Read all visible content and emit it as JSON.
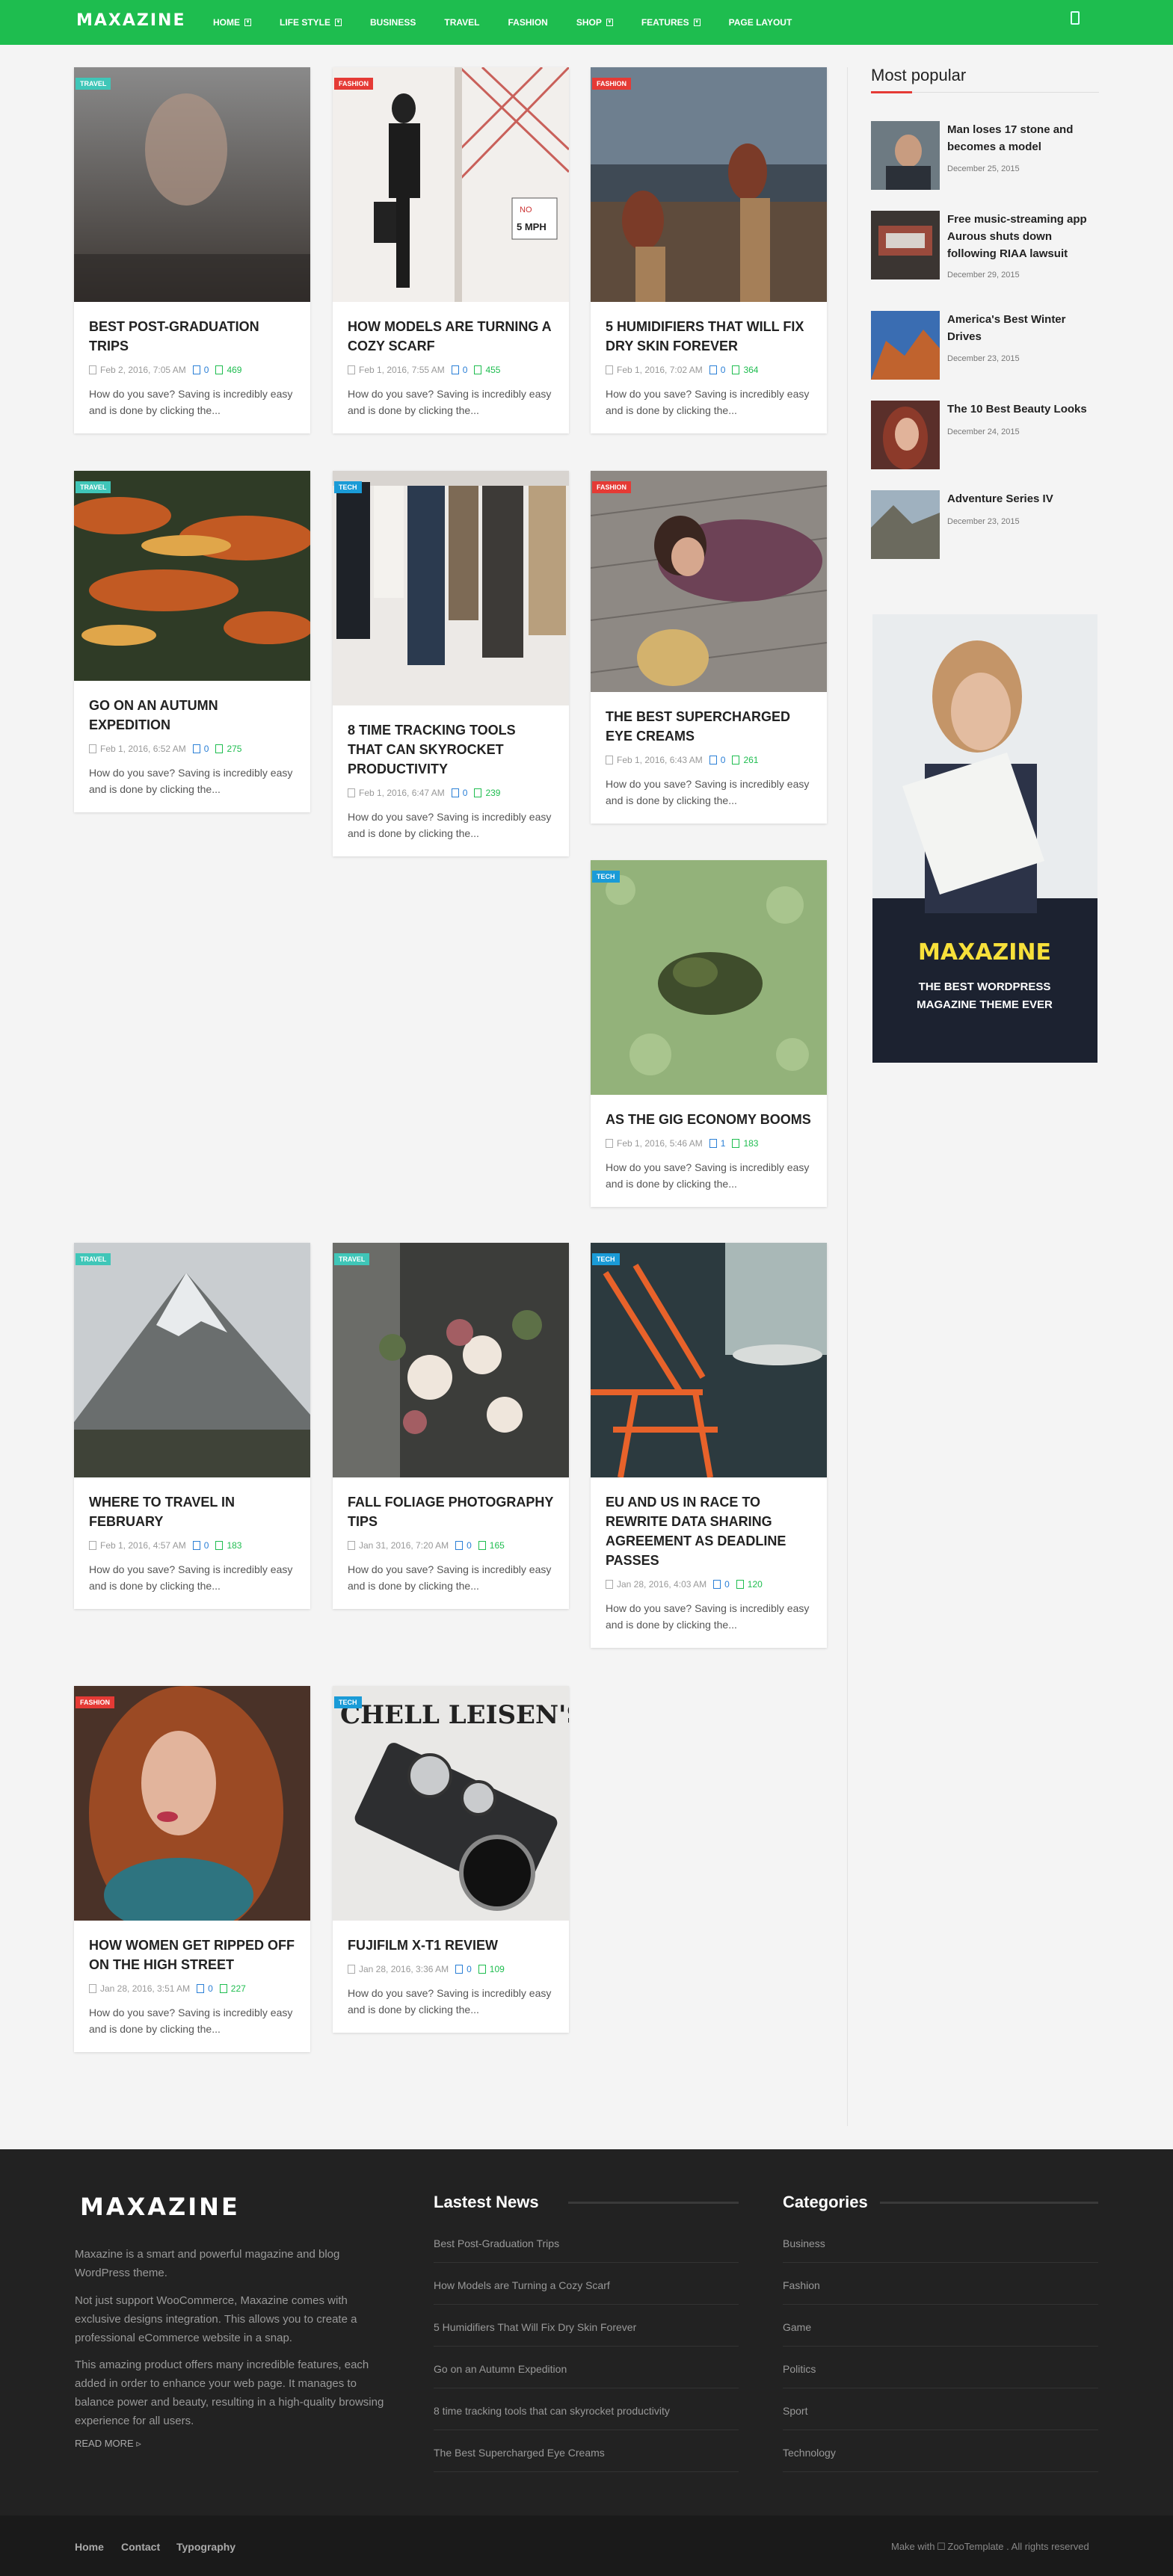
{
  "header": {
    "logo": "MAXAZINE",
    "nav": [
      {
        "label": "HOME",
        "caret": true
      },
      {
        "label": "LIFE STYLE",
        "caret": true
      },
      {
        "label": "BUSINESS",
        "caret": false
      },
      {
        "label": "TRAVEL",
        "caret": false
      },
      {
        "label": "FASHION",
        "caret": false
      },
      {
        "label": "SHOP",
        "caret": true
      },
      {
        "label": "FEATURES",
        "caret": true
      },
      {
        "label": "PAGE LAYOUT",
        "caret": false
      }
    ]
  },
  "colors": {
    "brand": "#1ebd4f",
    "travel": "#3fc6b8",
    "fashion": "#e53a35",
    "tech": "#1a9bd7",
    "comments": "#2a7fd6",
    "views": "#1ebd4f"
  },
  "posts": [
    {
      "category": "TRAVEL",
      "title": "BEST POST-GRADUATION TRIPS",
      "date": "Feb 2, 2016, 7:05 AM",
      "comments": "0",
      "views": "469",
      "excerpt": "How do you save? Saving is incredibly easy and is done by clicking the..."
    },
    {
      "category": "FASHION",
      "title": "HOW MODELS ARE TURNING A COZY SCARF",
      "date": "Feb 1, 2016, 7:55 AM",
      "comments": "0",
      "views": "455",
      "excerpt": "How do you save? Saving is incredibly easy and is done by clicking the..."
    },
    {
      "category": "FASHION",
      "title": "5 HUMIDIFIERS THAT WILL FIX DRY SKIN FOREVER",
      "date": "Feb 1, 2016, 7:02 AM",
      "comments": "0",
      "views": "364",
      "excerpt": "How do you save? Saving is incredibly easy and is done by clicking the..."
    },
    {
      "category": "TRAVEL",
      "title": "GO ON AN AUTUMN EXPEDITION",
      "date": "Feb 1, 2016, 6:52 AM",
      "comments": "0",
      "views": "275",
      "excerpt": "How do you save? Saving is incredibly easy and is done by clicking the..."
    },
    {
      "category": "TECH",
      "title": "8 TIME TRACKING TOOLS THAT CAN SKYROCKET PRODUCTIVITY",
      "date": "Feb 1, 2016, 6:47 AM",
      "comments": "0",
      "views": "239",
      "excerpt": "How do you save? Saving is incredibly easy and is done by clicking the..."
    },
    {
      "category": "FASHION",
      "title": "THE BEST SUPERCHARGED EYE CREAMS",
      "date": "Feb 1, 2016, 6:43 AM",
      "comments": "0",
      "views": "261",
      "excerpt": "How do you save? Saving is incredibly easy and is done by clicking the..."
    },
    {
      "category": "TECH",
      "title": "AS THE GIG ECONOMY BOOMS",
      "date": "Feb 1, 2016, 5:46 AM",
      "comments": "1",
      "views": "183",
      "excerpt": "How do you save? Saving is incredibly easy and is done by clicking the..."
    },
    {
      "category": "TRAVEL",
      "title": "WHERE TO TRAVEL IN FEBRUARY",
      "date": "Feb 1, 2016, 4:57 AM",
      "comments": "0",
      "views": "183",
      "excerpt": "How do you save? Saving is incredibly easy and is done by clicking the..."
    },
    {
      "category": "TRAVEL",
      "title": "FALL FOLIAGE PHOTOGRAPHY TIPS",
      "date": "Jan 31, 2016, 7:20 AM",
      "comments": "0",
      "views": "165",
      "excerpt": "How do you save? Saving is incredibly easy and is done by clicking the..."
    },
    {
      "category": "TECH",
      "title": "EU AND US IN RACE TO REWRITE DATA SHARING AGREEMENT AS DEADLINE PASSES",
      "date": "Jan 28, 2016, 4:03 AM",
      "comments": "0",
      "views": "120",
      "excerpt": "How do you save? Saving is incredibly easy and is done by clicking the..."
    },
    {
      "category": "FASHION",
      "title": "HOW WOMEN GET RIPPED OFF ON THE HIGH STREET",
      "date": "Jan 28, 2016, 3:51 AM",
      "comments": "0",
      "views": "227",
      "excerpt": "How do you save? Saving is incredibly easy and is done by clicking the..."
    },
    {
      "category": "TECH",
      "title": "FUJIFILM X-T1 REVIEW",
      "date": "Jan 28, 2016, 3:36 AM",
      "comments": "0",
      "views": "109",
      "excerpt": "How do you save? Saving is incredibly easy and is done by clicking the..."
    }
  ],
  "image_text": {
    "sign_no": "NO",
    "sign_speed": "5 MPH",
    "camera_brand": "CHELL LEISEN'S"
  },
  "sidebar": {
    "popular_title": "Most popular",
    "popular": [
      {
        "title": "Man loses 17 stone and becomes a model",
        "date": "December 25, 2015"
      },
      {
        "title": "Free music-streaming app Aurous shuts down following RIAA lawsuit",
        "date": "December 29, 2015"
      },
      {
        "title": "America's Best Winter Drives",
        "date": "December 23, 2015"
      },
      {
        "title": "The 10 Best Beauty Looks",
        "date": "December 24, 2015"
      },
      {
        "title": "Adventure Series IV",
        "date": "December 23, 2015"
      }
    ],
    "ad": {
      "brand": "MAXAZINE",
      "line1": "THE BEST WORDPRESS",
      "line2": "MAGAZINE THEME EVER"
    }
  },
  "footer": {
    "logo": "MAXAZINE",
    "about": [
      "Maxazine is a smart and powerful magazine and blog WordPress theme.",
      "Not just support WooCommerce, Maxazine comes with exclusive designs integration. This allows you to create a professional eCommerce website in a snap.",
      "This amazing product offers many incredible features, each added in order to enhance your web page. It manages to balance power and beauty, resulting in a high-quality browsing experience for all users."
    ],
    "read_more": "READ MORE",
    "news_title": "Lastest News",
    "news": [
      "Best Post-Graduation Trips",
      "How Models are Turning a Cozy Scarf",
      "5 Humidifiers That Will Fix Dry Skin Forever",
      "Go on an Autumn Expedition",
      "8 time tracking tools that can skyrocket productivity",
      "The Best Supercharged Eye Creams"
    ],
    "cat_title": "Categories",
    "categories": [
      "Business",
      "Fashion",
      "Game",
      "Politics",
      "Sport",
      "Technology"
    ]
  },
  "bottom": {
    "links": [
      "Home",
      "Contact",
      "Typography"
    ],
    "copyright": "Make with ☐ ZooTemplate . All rights reserved"
  }
}
